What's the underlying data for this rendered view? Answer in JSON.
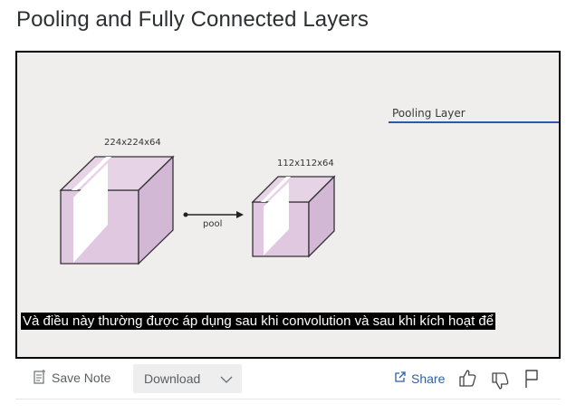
{
  "page": {
    "title": "Pooling and Fully Connected Layers"
  },
  "slide": {
    "layer_label": "Pooling Layer",
    "input_dims": "224x224x64",
    "output_dims": "112x112x64",
    "operation_label": "pool",
    "accent_color": "#2b5aa8",
    "cube_fill": "#dfc8e0"
  },
  "captions": {
    "text": "Và điều này thường được áp dụng sau khi convolution và sau khi kích hoạt để"
  },
  "toolbar": {
    "save_note_label": "Save Note",
    "download_label": "Download",
    "share_label": "Share",
    "icons": [
      "note-icon",
      "chevron-down-icon",
      "share-icon",
      "thumbs-up-icon",
      "thumbs-down-icon",
      "flag-icon"
    ]
  }
}
